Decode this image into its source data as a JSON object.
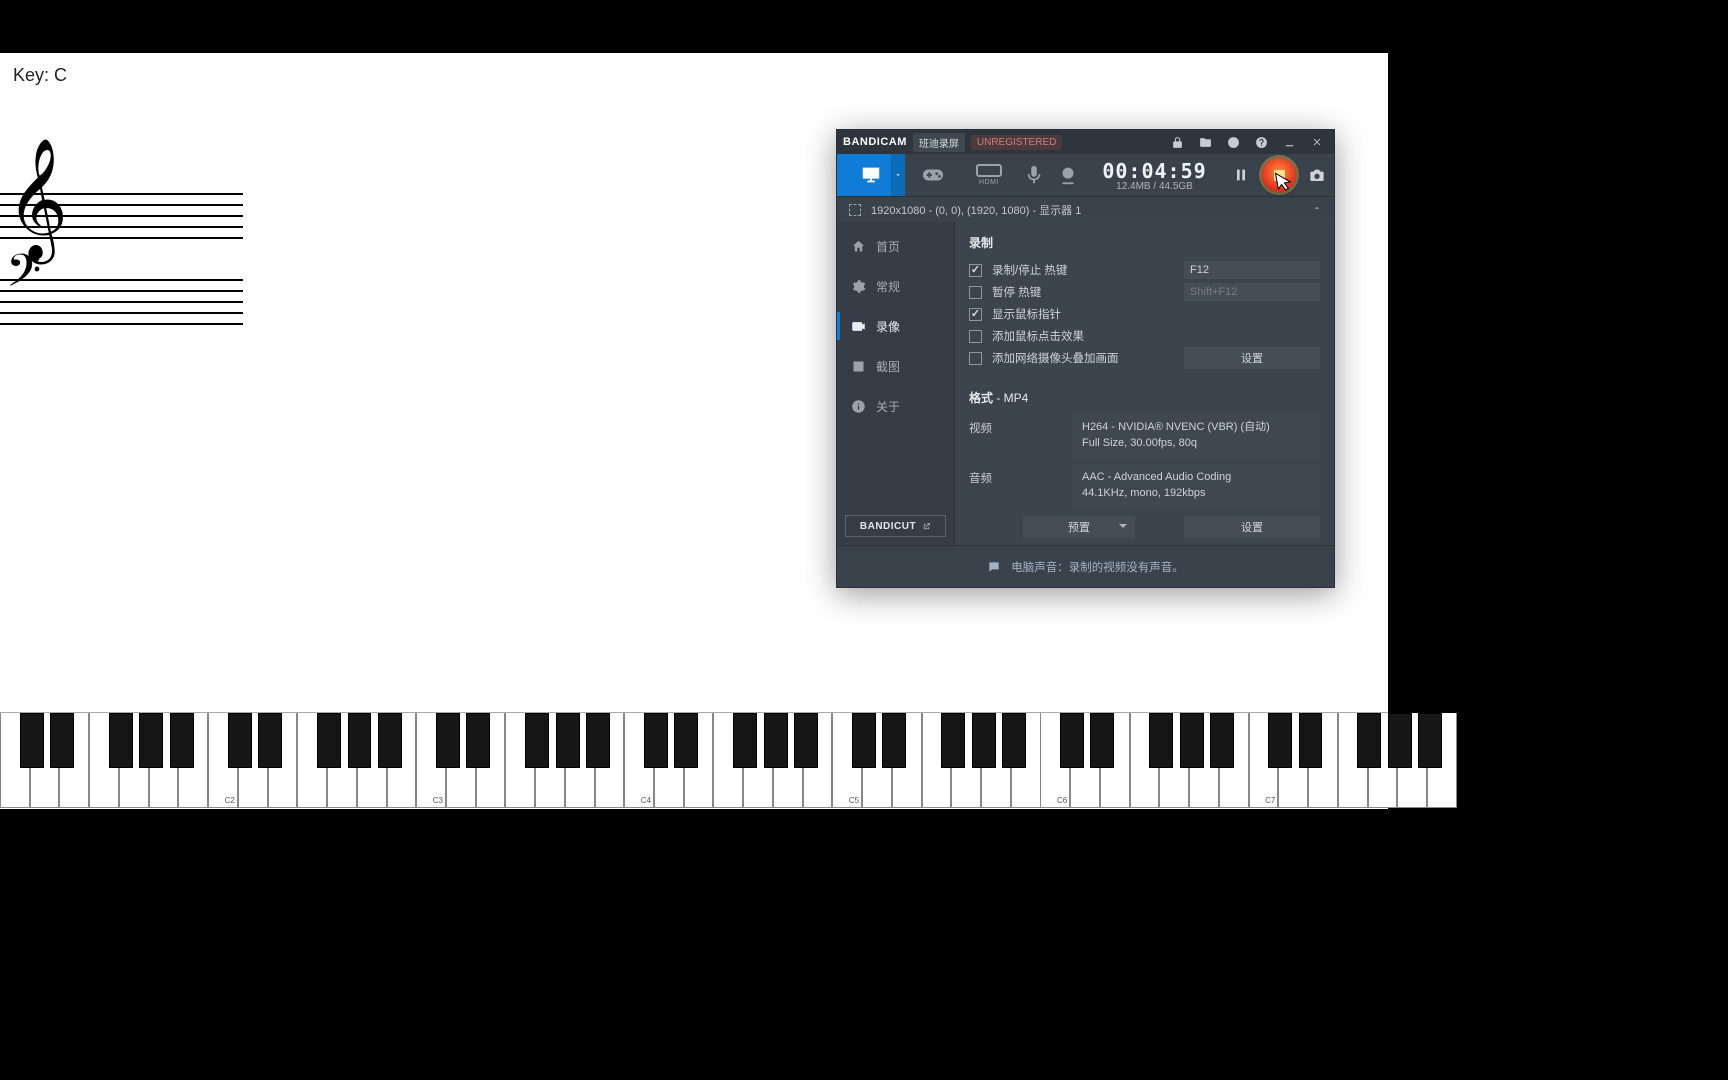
{
  "piano_app": {
    "key_label": "Key: C",
    "octave_labels": [
      "C2",
      "C3",
      "C4",
      "C5",
      "C6",
      "C7"
    ]
  },
  "bandicam": {
    "title": {
      "brand": "BANDICAM",
      "subtitle": "班迪录屏",
      "unregistered_badge": "UNREGISTERED"
    },
    "status": {
      "elapsed": "00:04:59",
      "used_space": "12.4MB / 44.5GB"
    },
    "source_line": "1920x1080 - (0, 0), (1920, 1080) - 显示器 1",
    "nav": {
      "home": "首页",
      "general": "常规",
      "video": "录像",
      "image": "截图",
      "about": "关于",
      "bandicut": "BANDICUT"
    },
    "record_section": {
      "heading": "录制",
      "rows": {
        "start_stop_hotkey_label": "录制/停止 热键",
        "start_stop_hotkey_value": "F12",
        "pause_hotkey_label": "暂停 热键",
        "pause_hotkey_value": "Shift+F12",
        "show_cursor_label": "显示鼠标指针",
        "click_effect_label": "添加鼠标点击效果",
        "webcam_overlay_label": "添加网络摄像头叠加画面",
        "settings_btn": "设置"
      },
      "checked": {
        "start_stop": true,
        "pause": false,
        "show_cursor": true,
        "click_effect": false,
        "webcam_overlay": false
      }
    },
    "format_section": {
      "heading_prefix": "格式",
      "heading_value": " - MP4",
      "video_label": "视频",
      "video_line1": "H264 - NVIDIA® NVENC (VBR) (自动)",
      "video_line2": "Full Size, 30.00fps, 80q",
      "audio_label": "音频",
      "audio_line1": "AAC - Advanced Audio Coding",
      "audio_line2": "44.1KHz, mono, 192kbps",
      "preset_btn": "预置",
      "settings_btn": "设置"
    },
    "footer_hint": "电脑声音：录制的视频没有声音。"
  }
}
